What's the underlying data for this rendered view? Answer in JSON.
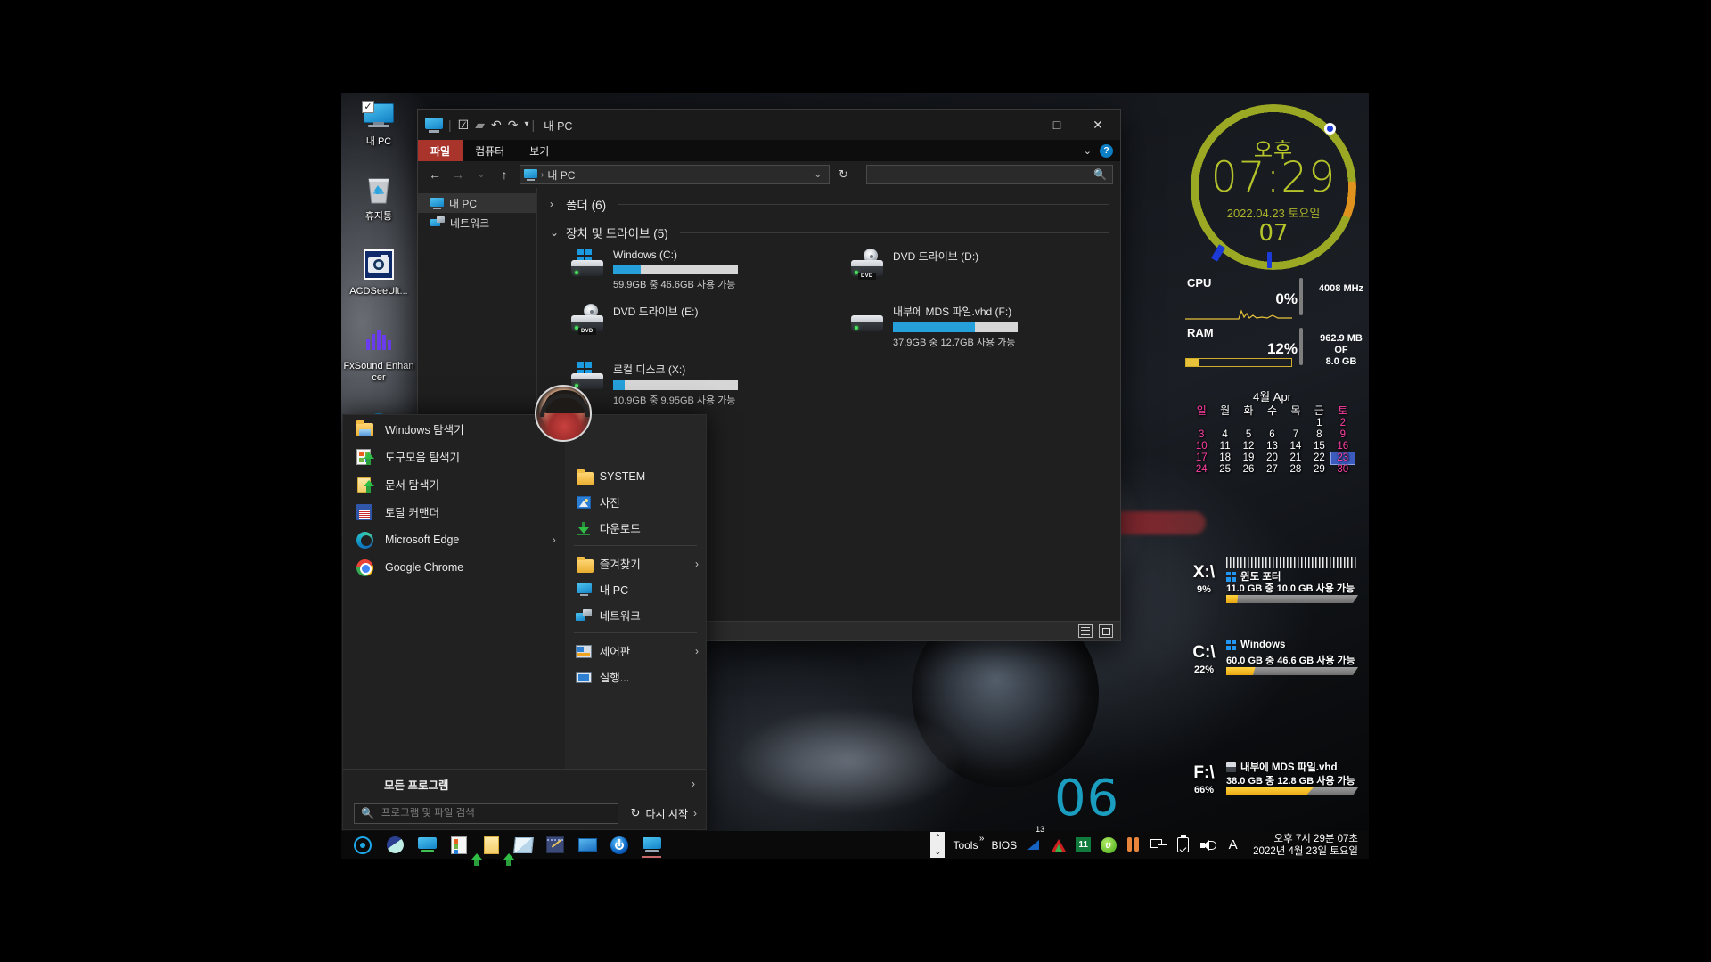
{
  "desktop": {
    "icons": [
      {
        "name": "내 PC",
        "icon": "monitor-checked-icon"
      },
      {
        "name": "휴지통",
        "icon": "recycle-bin-icon"
      },
      {
        "name": "ACDSeeUlt...",
        "icon": "acdsee-ultimate-icon"
      },
      {
        "name": "FxSound Enhancer",
        "icon": "fxsound-enhancer-icon"
      }
    ],
    "wallpaper_number": "06"
  },
  "explorer": {
    "title": "내 PC",
    "quick_access_icons": [
      "properties-icon",
      "new-folder-icon",
      "undo-icon",
      "redo-icon",
      "customize-icon"
    ],
    "window_buttons": {
      "minimize": "—",
      "maximize": "□",
      "close": "✕"
    },
    "ribbon_tabs": [
      {
        "label": "파일",
        "active": true
      },
      {
        "label": "컴퓨터",
        "active": false
      },
      {
        "label": "보기",
        "active": false
      }
    ],
    "ribbon_right": {
      "collapse": "⌄",
      "help": "?"
    },
    "nav": {
      "back": "←",
      "forward": "→",
      "recent": "⌄",
      "up": "↑",
      "refresh": "↻",
      "dropdown": "⌄"
    },
    "address": {
      "icon": "this-pc-icon",
      "separator": "›",
      "text": "내 PC"
    },
    "search": {
      "placeholder": "",
      "value": "",
      "icon": "search-icon"
    },
    "nav_pane": [
      {
        "label": "내 PC",
        "icon": "this-pc-icon",
        "selected": true
      },
      {
        "label": "네트워크",
        "icon": "network-icon",
        "selected": false
      }
    ],
    "groups": [
      {
        "label": "폴더 (6)",
        "expanded": false,
        "twisty": "›"
      },
      {
        "label": "장치 및 드라이브 (5)",
        "expanded": true,
        "twisty": "⌄"
      }
    ],
    "drives": [
      {
        "name": "Windows (C:)",
        "capacity": "59.9GB 중 46.6GB 사용 가능",
        "fill_pct": 22,
        "icon": "hard-drive-windows-icon",
        "has_bar": true
      },
      {
        "name": "DVD 드라이브 (D:)",
        "capacity": "",
        "fill_pct": 0,
        "icon": "dvd-drive-icon",
        "has_bar": false,
        "tag": "DVD"
      },
      {
        "name": "DVD 드라이브 (E:)",
        "capacity": "",
        "fill_pct": 0,
        "icon": "dvd-drive-icon",
        "has_bar": false,
        "tag": "DVD"
      },
      {
        "name": "내부에 MDS 파일.vhd (F:)",
        "capacity": "37.9GB 중 12.7GB 사용 가능",
        "fill_pct": 66,
        "icon": "hard-drive-icon",
        "has_bar": true
      },
      {
        "name": "로컬 디스크 (X:)",
        "capacity": "10.9GB 중 9.95GB 사용 가능",
        "fill_pct": 9,
        "icon": "hard-drive-windows-icon",
        "has_bar": true
      }
    ],
    "status_buttons": [
      {
        "icon": "details-view-icon"
      },
      {
        "icon": "large-icons-view-icon"
      }
    ]
  },
  "start_menu": {
    "left_items": [
      {
        "label": "Windows 탐색기",
        "icon": "folder-explorer-icon",
        "submenu": ""
      },
      {
        "label": "도구모음 탐색기",
        "icon": "toolbar-explorer-icon",
        "submenu": ""
      },
      {
        "label": "문서 탐색기",
        "icon": "documents-explorer-icon",
        "submenu": ""
      },
      {
        "label": "토탈 커맨더",
        "icon": "total-commander-icon",
        "submenu": ""
      },
      {
        "label": "Microsoft Edge",
        "icon": "edge-icon",
        "submenu": "›"
      },
      {
        "label": "Google Chrome",
        "icon": "chrome-icon",
        "submenu": ""
      }
    ],
    "right_items": [
      {
        "label": "SYSTEM",
        "icon": "folder-icon",
        "submenu": "",
        "divider_after": false
      },
      {
        "label": "사진",
        "icon": "pictures-icon",
        "submenu": "",
        "divider_after": false
      },
      {
        "label": "다운로드",
        "icon": "downloads-icon",
        "submenu": "",
        "divider_after": true
      },
      {
        "label": "즐겨찾기",
        "icon": "favorites-folder-icon",
        "submenu": "›",
        "divider_after": false
      },
      {
        "label": "내 PC",
        "icon": "this-pc-icon",
        "submenu": "",
        "divider_after": false
      },
      {
        "label": "네트워크",
        "icon": "network-icon",
        "submenu": "",
        "divider_after": true
      },
      {
        "label": "제어판",
        "icon": "control-panel-icon",
        "submenu": "›",
        "divider_after": false
      },
      {
        "label": "실행...",
        "icon": "run-icon",
        "submenu": "",
        "divider_after": false
      }
    ],
    "all_programs": {
      "label": "모든 프로그램",
      "chevron": "›"
    },
    "search": {
      "placeholder": "프로그램 및 파일 검색",
      "value": "",
      "icon": "search-icon"
    },
    "restart": {
      "label": "다시 시작",
      "icon": "restart-icon",
      "chevron": "›"
    },
    "avatar": "user-avatar"
  },
  "gadgets": {
    "clock": {
      "ampm": "오후",
      "time": "07:29",
      "date": "2022.04.23 토요일",
      "seconds": "07",
      "ring_color": "#9aa823",
      "accent_color": "#e0921f"
    },
    "performance": {
      "cpu": {
        "label": "CPU",
        "percent": "0%",
        "meta": "4008 MHz"
      },
      "ram": {
        "label": "RAM",
        "percent": "12%",
        "meta_line1": "962.9 MB",
        "meta_line2": "OF",
        "meta_line3": "8.0 GB"
      }
    },
    "calendar": {
      "title": "4월 Apr",
      "weekdays": [
        "일",
        "월",
        "화",
        "수",
        "목",
        "금",
        "토"
      ],
      "weeks": [
        [
          "",
          "",
          "",
          "",
          "",
          "1",
          "2"
        ],
        [
          "3",
          "4",
          "5",
          "6",
          "7",
          "8",
          "9"
        ],
        [
          "10",
          "11",
          "12",
          "13",
          "14",
          "15",
          "16"
        ],
        [
          "17",
          "18",
          "19",
          "20",
          "21",
          "22",
          "23"
        ],
        [
          "24",
          "25",
          "26",
          "27",
          "28",
          "29",
          "30"
        ]
      ],
      "today": "23"
    },
    "disks": [
      {
        "letter": "X:\\",
        "percent": "9%",
        "name": "윈도 포터",
        "capacity": "11.0 GB 중   10.0 GB 사용 가능",
        "fill_pct": 9,
        "icon": "windows-icon",
        "hatched": true
      },
      {
        "letter": "C:\\",
        "percent": "22%",
        "name": "Windows",
        "capacity": "60.0 GB 중   46.6 GB 사용 가능",
        "fill_pct": 22,
        "icon": "windows-icon",
        "hatched": false
      },
      {
        "letter": "F:\\",
        "percent": "66%",
        "name": "내부에 MDS 파일.vhd",
        "capacity": "38.0 GB 중   12.8 GB 사용 가능",
        "fill_pct": 66,
        "icon": "vhd-icon",
        "hatched": false
      }
    ]
  },
  "taskbar": {
    "apps": [
      {
        "icon": "rainmeter-icon",
        "active": false
      },
      {
        "icon": "teal-orb-icon",
        "active": false
      },
      {
        "icon": "monitor-green-icon",
        "active": false
      },
      {
        "icon": "toolbar-explorer-icon",
        "active": false
      },
      {
        "icon": "documents-explorer-icon",
        "active": false
      },
      {
        "icon": "paper-app-icon",
        "active": false
      },
      {
        "icon": "notepad-icon",
        "active": false
      },
      {
        "icon": "blue-screen-icon",
        "active": false
      },
      {
        "icon": "power-icon",
        "active": false
      },
      {
        "icon": "this-pc-icon",
        "active": true
      }
    ],
    "tray": {
      "scroll_up": "⌃",
      "scroll_down": "⌄",
      "tools_label": "Tools",
      "tools_sup": "»",
      "bios_label": "BIOS",
      "icons": [
        {
          "icon": "blue-triangle-icon",
          "badge": "13"
        },
        {
          "icon": "red-green-arrow-icon",
          "badge": ""
        },
        {
          "icon": "green-11-icon",
          "badge": "11"
        },
        {
          "icon": "utorrent-icon",
          "badge": ""
        },
        {
          "icon": "orange-bars-icon",
          "badge": ""
        },
        {
          "icon": "network-icon",
          "badge": ""
        },
        {
          "icon": "safely-remove-usb-icon",
          "badge": ""
        },
        {
          "icon": "volume-icon",
          "badge": ""
        },
        {
          "icon": "ime-A-icon",
          "badge": ""
        }
      ]
    },
    "clock": {
      "time": "오후 7시 29분 07초",
      "date": "2022년  4월  23일  토요일"
    }
  }
}
